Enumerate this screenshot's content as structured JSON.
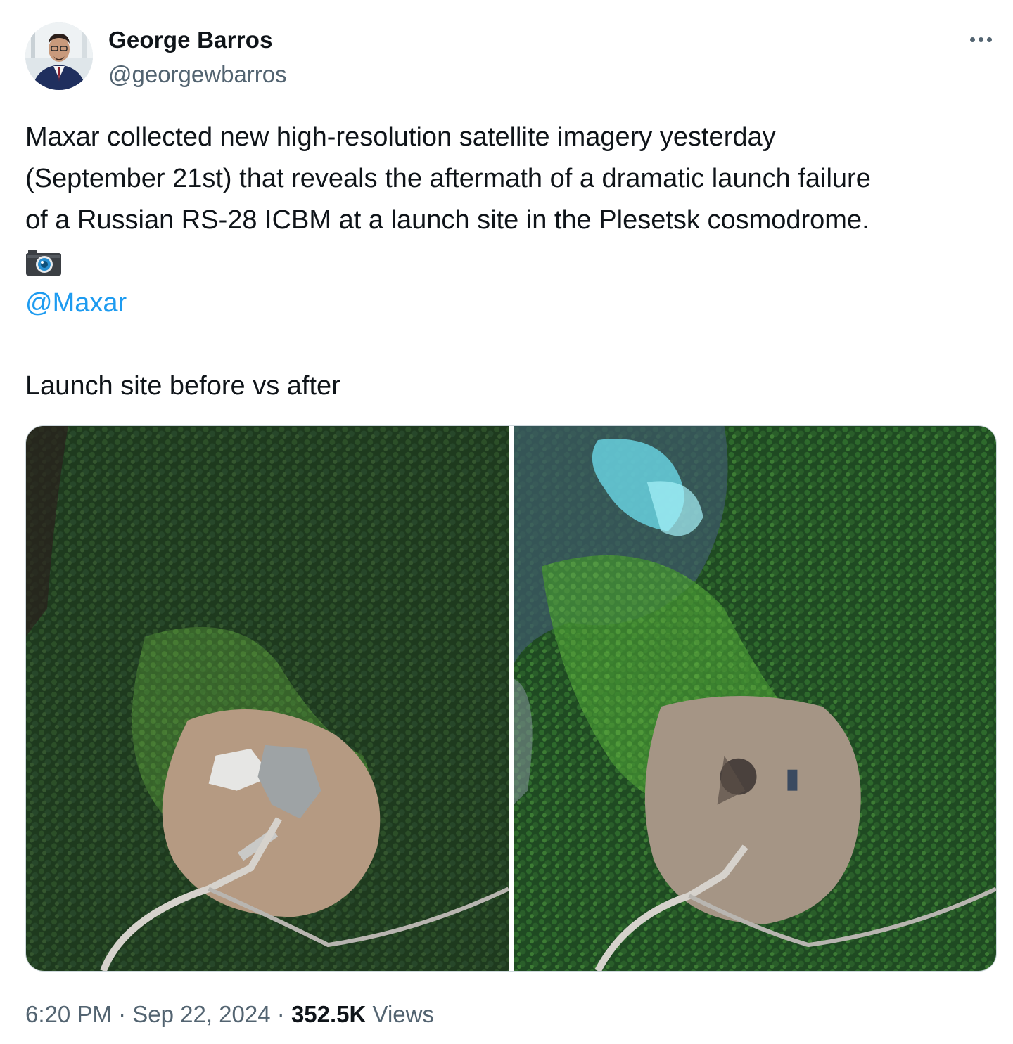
{
  "author": {
    "display_name": "George Barros",
    "handle": "@georgewbarros"
  },
  "tweet": {
    "lines": [
      "Maxar collected new high-resolution satellite imagery yesterday",
      "(September 21st) that reveals the aftermath of a dramatic launch failure",
      "of a Russian RS-28 ICBM at a launch site in the Plesetsk cosmodrome."
    ],
    "camera_emoji": "📷",
    "mention": "@Maxar",
    "caption": "Launch site before vs after"
  },
  "media": [
    {
      "icon": "satellite-image-before"
    },
    {
      "icon": "satellite-image-after"
    }
  ],
  "meta": {
    "time": "6:20 PM",
    "separator": "·",
    "date": "Sep 22, 2024",
    "views_count": "352.5K",
    "views_label": "Views"
  },
  "colors": {
    "text": "#0f1419",
    "secondary": "#536471",
    "link": "#1d9bf0"
  }
}
